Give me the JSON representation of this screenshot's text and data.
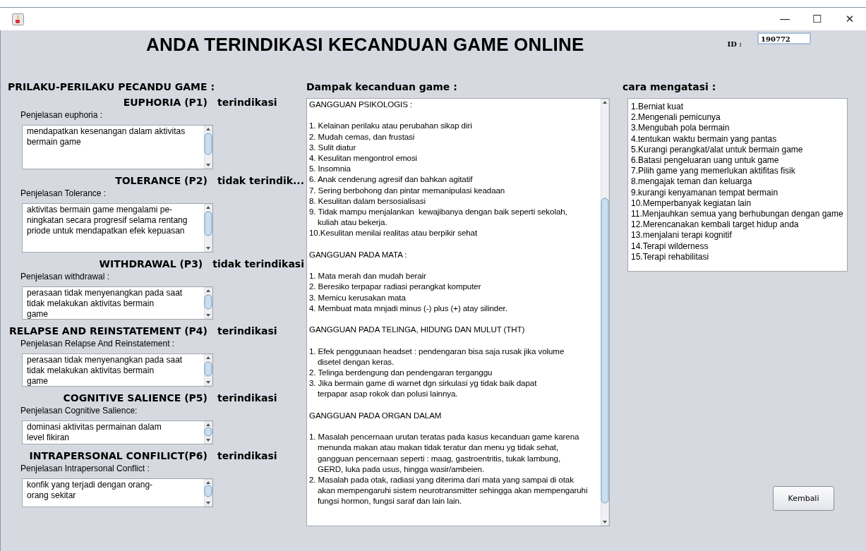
{
  "window": {
    "controls": [
      "—",
      "☐",
      "✕"
    ]
  },
  "title": "ANDA TERINDIKASI KECANDUAN GAME ONLINE",
  "id_field": {
    "label": "ID :",
    "value": "190772"
  },
  "behaviors": {
    "heading": "PRILAKU-PERILAKU PECANDU GAME :",
    "items": [
      {
        "name": "EUPHORIA (P1)",
        "status": "terindikasi",
        "explanation_label": "Penjelasan euphoria :",
        "lines": [
          "mendapatkan kesenangan dalam aktivitas",
          "bermain game"
        ]
      },
      {
        "name": "TOLERANCE (P2)",
        "status": "tidak terindik...",
        "explanation_label": "Penjelasan Tolerance :",
        "lines": [
          "aktivitas bermain game mengalami pe-",
          "ningkatan secara progresif selama rentang",
          "priode untuk mendapatkan efek kepuasan"
        ]
      },
      {
        "name": "WITHDRAWAL (P3)",
        "status": "tidak terindikasi",
        "explanation_label": "Penjelasan withdrawal :",
        "lines": [
          "perasaan tidak menyenangkan pada saat",
          "tidak melakukan aktivitas bermain",
          "game"
        ]
      },
      {
        "name": "RELAPSE AND REINSTATEMENT (P4)",
        "status": "terindikasi",
        "explanation_label": "Penjelasan Relapse And Reinstatement :",
        "lines": [
          "perasaan tidak menyenangkan pada saat",
          "tidak melakukan aktivitas bermain",
          "game"
        ]
      },
      {
        "name": "COGNITIVE SALIENCE (P5)",
        "status": "terindikasi",
        "explanation_label": "Penjelasan Cognitive Salience:",
        "lines": [
          "dominasi aktivitas permainan dalam",
          "level fikiran"
        ]
      },
      {
        "name": "INTRAPERSONAL CONFILICT(P6)",
        "status": "terindikasi",
        "explanation_label": "Penjelasan Intrapersonal Conflict :",
        "lines": [
          "konfik yang terjadi dengan orang-",
          "orang sekitar"
        ]
      }
    ]
  },
  "impact": {
    "heading": "Dampak kecanduan game :",
    "sections": [
      {
        "heading": "GANGGUAN PSIKOLOGIS :",
        "items": [
          [
            "1. Kelainan perilaku atau perubahan sikap diri"
          ],
          [
            "2. Mudah cemas, dan frustasi"
          ],
          [
            "3. Sulit diatur"
          ],
          [
            "4. Kesulitan mengontrol emosi"
          ],
          [
            "5. Insomnia"
          ],
          [
            "6. Anak cenderung agresif dan bahkan agitatif"
          ],
          [
            "7. Sering berbohong dan pintar memanipulasi keadaan"
          ],
          [
            "8. Kesulitan dalam bersosialisasi"
          ],
          [
            "9. Tidak mampu menjalankan  kewajibanya dengan baik seperti sekolah,",
            "kuliah atau bekerja."
          ],
          [
            "10.Kesulitan menilai realitas atau berpikir sehat"
          ]
        ]
      },
      {
        "heading": "GANGGUAN PADA MATA :",
        "items": [
          [
            "1. Mata merah dan mudah berair"
          ],
          [
            "2. Beresiko terpapar radiasi perangkat komputer"
          ],
          [
            "3. Memicu kerusakan mata"
          ],
          [
            "4. Membuat mata mnjadi minus (-) plus (+) atay silinder."
          ]
        ]
      },
      {
        "heading": "GANGGUAN PADA TELINGA, HIDUNG DAN MULUT (THT)",
        "items": [
          [
            "1. Efek penggunaan headset : pendengaran bisa saja rusak jika volume",
            "disetel dengan keras."
          ],
          [
            "2. Telinga berdengung dan pendengaran terganggu"
          ],
          [
            "3. Jika bermain game di warnet dgn sirkulasi yg tidak baik dapat",
            "terpapar asap rokok dan polusi lainnya."
          ]
        ]
      },
      {
        "heading": "GANGGUAN PADA ORGAN DALAM",
        "items": [
          [
            "1. Masalah pencernaan urutan teratas pada kasus kecanduan game karena",
            "menunda makan atau makan tidak teratur dan menu yg tidak sehat,",
            "gangguan pencernaan seperti : maag, gastroentritis, tukak lambung,",
            "GERD, luka pada usus, hingga wasir/ambeien."
          ],
          [
            "2. Masalah pada otak, radiasi yang diterima dari mata yang sampai di otak",
            "akan mempengaruhi sistem neurotransmitter sehingga akan mempengaruhi",
            "fungsi hormon, fungsi saraf dan lain lain."
          ]
        ]
      }
    ]
  },
  "solutions": {
    "heading": "cara mengatasi :",
    "items": [
      "1.Berniat kuat",
      "2.Mengenali pemicunya",
      "3.Mengubah pola bermain",
      "4.tentukan waktu bermain yang pantas",
      "5.Kurangi perangkat/alat untuk bermain game",
      "6.Batasi pengeluaran uang untuk game",
      "7.Pilih game yang memerlukan aktifitas fisik",
      "8.mengajak teman dan keluarga",
      "9.kurangi kenyamanan tempat bermain",
      "10.Memperbanyak kegiatan lain",
      "11.Menjauhkan semua yang berhubungan dengan game",
      "12.Merencanakan kembali target hidup anda",
      "13.menjalani terapi kognitif",
      "14.Terapi wilderness",
      "15.Terapi rehabilitasi"
    ]
  },
  "back_button": "Kembali"
}
